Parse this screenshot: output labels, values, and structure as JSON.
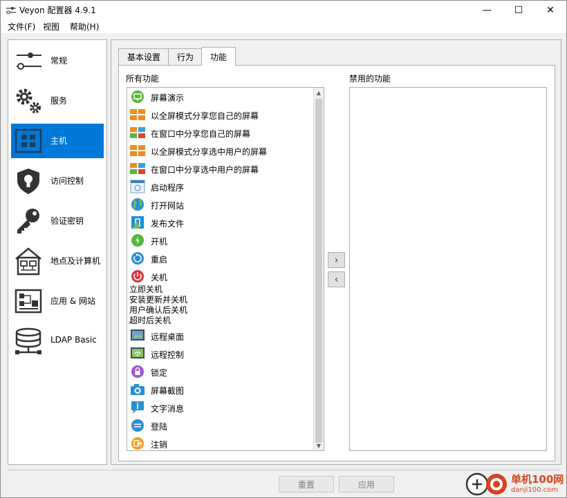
{
  "window": {
    "title": "Veyon 配置器 4.9.1",
    "controls": {
      "minimize": "—",
      "maximize": "☐",
      "close": "✕"
    }
  },
  "menu": [
    {
      "label": "文件(F)"
    },
    {
      "label": "视图"
    },
    {
      "label": "帮助(H)"
    }
  ],
  "sidebar": {
    "items": [
      {
        "label": "常规",
        "icon": "sliders-icon"
      },
      {
        "label": "服务",
        "icon": "gears-icon"
      },
      {
        "label": "主机",
        "icon": "master-grid-icon",
        "active": true
      },
      {
        "label": "访问控制",
        "icon": "shield-lock-icon"
      },
      {
        "label": "验证密钥",
        "icon": "key-icon"
      },
      {
        "label": "地点及计算机",
        "icon": "house-computers-icon"
      },
      {
        "label": "应用 & 网站",
        "icon": "apps-websites-icon"
      },
      {
        "label": "LDAP Basic",
        "icon": "database-icon"
      }
    ]
  },
  "tabs": [
    {
      "label": "基本设置"
    },
    {
      "label": "行为"
    },
    {
      "label": "功能",
      "active": true
    }
  ],
  "all_features": {
    "heading": "所有功能",
    "items": [
      {
        "label": "屏幕演示",
        "icon": "screen-presentation-icon"
      },
      {
        "label": "以全屏模式分享您自己的屏幕",
        "icon": "fullscreen-share-icon"
      },
      {
        "label": "在窗口中分享您自己的屏幕",
        "icon": "window-share-icon"
      },
      {
        "label": "以全屏模式分享选中用户的屏幕",
        "icon": "fullscreen-share-icon"
      },
      {
        "label": "在窗口中分享选中用户的屏幕",
        "icon": "window-share-icon"
      },
      {
        "label": "启动程序",
        "icon": "program-icon"
      },
      {
        "label": "打开网站",
        "icon": "globe-icon"
      },
      {
        "label": "发布文件",
        "icon": "file-icon"
      },
      {
        "label": "开机",
        "icon": "power-on-icon"
      },
      {
        "label": "重启",
        "icon": "reboot-icon"
      },
      {
        "label": "关机",
        "icon": "power-off-icon"
      }
    ],
    "text_items": [
      {
        "label": "立即关机"
      },
      {
        "label": "安装更新并关机"
      },
      {
        "label": "用户确认后关机"
      },
      {
        "label": "超时后关机"
      }
    ],
    "items_after": [
      {
        "label": "远程桌面",
        "icon": "remote-desktop-icon"
      },
      {
        "label": "远程控制",
        "icon": "remote-control-icon"
      },
      {
        "label": "锁定",
        "icon": "lock-icon"
      },
      {
        "label": "屏幕截图",
        "icon": "camera-icon"
      },
      {
        "label": "文字消息",
        "icon": "message-icon"
      },
      {
        "label": "登陆",
        "icon": "login-icon"
      },
      {
        "label": "注销",
        "icon": "logout-icon"
      }
    ]
  },
  "disabled_features": {
    "heading": "禁用的功能",
    "items": []
  },
  "move_buttons": {
    "right": "›",
    "left": "‹"
  },
  "footer": {
    "reset": "重置",
    "apply": "应用"
  },
  "watermark": {
    "text": "单机100网",
    "url": "danji100.com"
  },
  "colors": {
    "accent": "#0078d7",
    "watermark": "#d8431d"
  }
}
